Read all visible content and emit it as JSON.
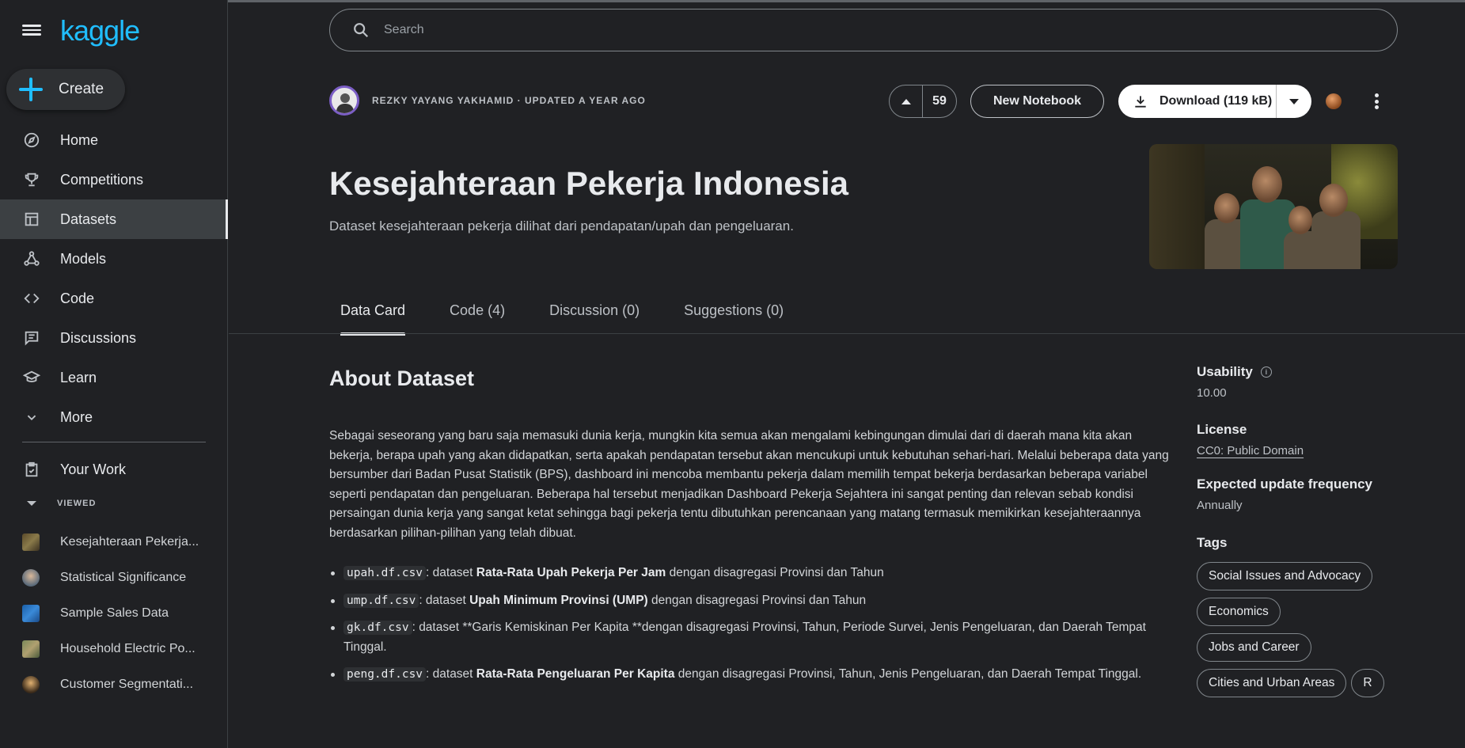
{
  "app": {
    "logo": "kaggle"
  },
  "sidebar": {
    "create_label": "Create",
    "items": [
      {
        "label": "Home",
        "icon": "compass-icon"
      },
      {
        "label": "Competitions",
        "icon": "trophy-icon"
      },
      {
        "label": "Datasets",
        "icon": "table-icon",
        "active": true
      },
      {
        "label": "Models",
        "icon": "models-icon"
      },
      {
        "label": "Code",
        "icon": "code-icon"
      },
      {
        "label": "Discussions",
        "icon": "discussion-icon"
      },
      {
        "label": "Learn",
        "icon": "learn-icon"
      },
      {
        "label": "More",
        "icon": "chevron-down-icon"
      }
    ],
    "your_work": "Your Work",
    "viewed_heading": "VIEWED",
    "recent": [
      {
        "label": "Kesejahteraan Pekerja..."
      },
      {
        "label": "Statistical Significance"
      },
      {
        "label": "Sample Sales Data"
      },
      {
        "label": "Household Electric Po..."
      },
      {
        "label": "Customer Segmentati..."
      }
    ]
  },
  "search": {
    "placeholder": "Search"
  },
  "dataset": {
    "author_line": "REZKY YAYANG YAKHAMID · UPDATED A YEAR AGO",
    "votes": "59",
    "new_notebook": "New Notebook",
    "download": "Download (119 kB)",
    "title": "Kesejahteraan Pekerja Indonesia",
    "subtitle": "Dataset kesejahteraan pekerja dilihat dari pendapatan/upah dan pengeluaran."
  },
  "tabs": [
    {
      "label": "Data Card",
      "active": true
    },
    {
      "label": "Code (4)"
    },
    {
      "label": "Discussion (0)"
    },
    {
      "label": "Suggestions (0)"
    }
  ],
  "about": {
    "heading": "About Dataset",
    "paragraph": "Sebagai seseorang yang baru saja memasuki dunia kerja, mungkin kita semua akan mengalami kebingungan dimulai dari di daerah mana kita akan bekerja, berapa upah yang akan didapatkan, serta apakah pendapatan tersebut akan mencukupi untuk kebutuhan sehari-hari. Melalui beberapa data yang bersumber dari Badan Pusat Statistik (BPS), dashboard ini mencoba membantu pekerja dalam memilih tempat bekerja berdasarkan beberapa variabel seperti pendapatan dan pengeluaran. Beberapa hal tersebut menjadikan Dashboard Pekerja Sejahtera ini sangat penting dan relevan sebab kondisi persaingan dunia kerja yang sangat ketat sehingga bagi pekerja tentu dibutuhkan perencanaan yang matang termasuk memikirkan kesejahteraannya berdasarkan pilihan-pilihan yang telah dibuat.",
    "files": [
      {
        "code": "upah.df.csv",
        "pre": ": dataset ",
        "bold": "Rata-Rata Upah Pekerja Per Jam",
        "post": " dengan disagregasi Provinsi dan Tahun"
      },
      {
        "code": "ump.df.csv",
        "pre": ": dataset ",
        "bold": "Upah Minimum Provinsi (UMP)",
        "post": " dengan disagregasi Provinsi dan Tahun"
      },
      {
        "code": "gk.df.csv",
        "pre": ": dataset **Garis Kemiskinan Per Kapita **dengan disagregasi Provinsi, Tahun, Periode Survei, Jenis Pengeluaran, dan Daerah Tempat Tinggal.",
        "bold": "",
        "post": ""
      },
      {
        "code": "peng.df.csv",
        "pre": ": dataset ",
        "bold": "Rata-Rata Pengeluaran Per Kapita",
        "post": " dengan disagregasi Provinsi, Tahun, Jenis Pengeluaran, dan Daerah Tempat Tinggal."
      }
    ]
  },
  "meta": {
    "usability_label": "Usability",
    "usability_value": "10.00",
    "license_label": "License",
    "license_value": "CC0: Public Domain",
    "frequency_label": "Expected update frequency",
    "frequency_value": "Annually",
    "tags_label": "Tags",
    "tags": [
      "Social Issues and Advocacy",
      "Economics",
      "Jobs and Career",
      "Cities and Urban Areas",
      "R"
    ]
  },
  "colors": {
    "accent": "#20beff",
    "background": "#202124"
  }
}
